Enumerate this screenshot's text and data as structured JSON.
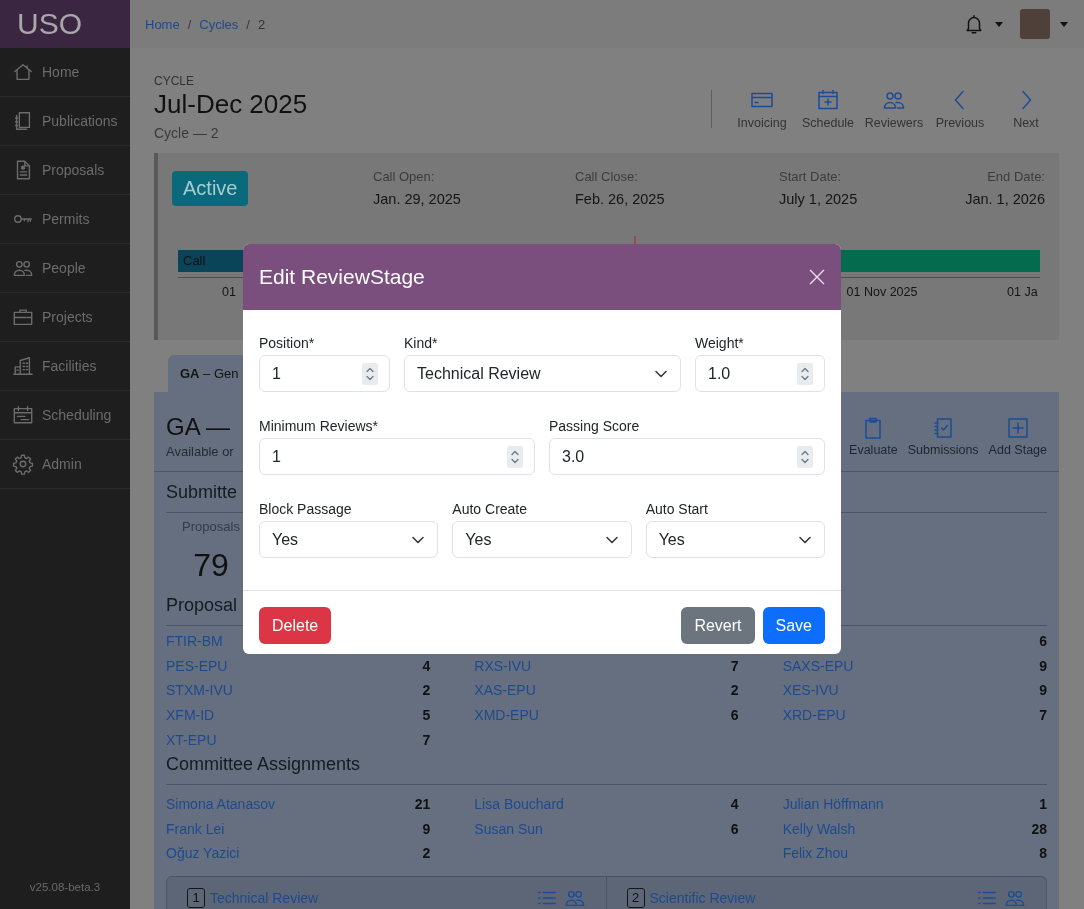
{
  "sidebar": {
    "logo": "USO",
    "items": [
      {
        "label": "Home"
      },
      {
        "label": "Publications"
      },
      {
        "label": "Proposals"
      },
      {
        "label": "Permits"
      },
      {
        "label": "People"
      },
      {
        "label": "Projects"
      },
      {
        "label": "Facilities"
      },
      {
        "label": "Scheduling"
      },
      {
        "label": "Admin"
      }
    ],
    "version": "v25.08-beta.3"
  },
  "breadcrumb": {
    "separator": "/",
    "items": [
      {
        "label": "Home",
        "kind": "link"
      },
      {
        "label": "Cycles",
        "kind": "link"
      },
      {
        "label": "2",
        "kind": "current"
      }
    ]
  },
  "header": {
    "eyebrow": "CYCLE",
    "title": "Jul-Dec 2025",
    "subtitle": "Cycle — 2",
    "actions": [
      {
        "label": "Invoicing"
      },
      {
        "label": "Schedule"
      },
      {
        "label": "Reviewers"
      },
      {
        "label": "Previous"
      },
      {
        "label": "Next"
      }
    ]
  },
  "summary": {
    "status": "Active",
    "dates": [
      {
        "label": "Call Open:",
        "value": "Jan. 29, 2025"
      },
      {
        "label": "Call Close:",
        "value": "Feb. 26, 2025"
      },
      {
        "label": "Start Date:",
        "value": "July 1, 2025"
      },
      {
        "label": "End Date:",
        "value": "Jan. 1, 2026"
      }
    ],
    "timeline": {
      "bar_label": "Call",
      "axis_labels": [
        "01",
        "01 Nov 2025",
        "01 Ja"
      ]
    }
  },
  "tabs": [
    {
      "label": "**GA** – Gen",
      "selected": true
    }
  ],
  "panel": {
    "title": "GA —",
    "subtitle": "Available or",
    "actions": [
      {
        "label": "Evaluate"
      },
      {
        "label": "Submissions"
      },
      {
        "label": "Add Stage"
      }
    ],
    "submitted": {
      "heading": "Submitte",
      "stats": [
        {
          "label": "Proposals",
          "value": "79"
        }
      ]
    },
    "proposals": {
      "heading": "Proposal",
      "rows": [
        {
          "column_1": {
            "name": "FTIR-BM"
          },
          "column_3": {
            "count": "6"
          }
        },
        {
          "column_1": {
            "name": "PES-EPU",
            "count": "4"
          },
          "column_2": {
            "name": "RXS-IVU",
            "count": "7"
          },
          "column_3": {
            "name": "SAXS-EPU",
            "count": "9"
          }
        },
        {
          "column_1": {
            "name": "STXM-IVU",
            "count": "2"
          },
          "column_2": {
            "name": "XAS-EPU",
            "count": "2"
          },
          "column_3": {
            "name": "XES-IVU",
            "count": "9"
          }
        },
        {
          "column_1": {
            "name": "XFM-ID",
            "count": "5"
          },
          "column_2": {
            "name": "XMD-EPU",
            "count": "6"
          },
          "column_3": {
            "name": "XRD-EPU",
            "count": "7"
          }
        },
        {
          "column_1": {
            "name": "XT-EPU",
            "count": "7"
          }
        }
      ]
    },
    "committee": {
      "heading": "Committee Assignments",
      "rows": [
        {
          "column_1": {
            "name": "Simona Atanasov",
            "count": "21"
          },
          "column_2": {
            "name": "Lisa Bouchard",
            "count": "4"
          },
          "column_3": {
            "name": "Julian Höffmann",
            "count": "1"
          }
        },
        {
          "column_1": {
            "name": "Frank Lei",
            "count": "9"
          },
          "column_2": {
            "name": "Susan Sun",
            "count": "6"
          },
          "column_3": {
            "name": "Kelly Walsh",
            "count": "28"
          }
        },
        {
          "column_1": {
            "name": "Oğuz Yazici",
            "count": "2"
          },
          "column_3": {
            "name": "Felix Zhou",
            "count": "8"
          }
        }
      ]
    },
    "stages": [
      {
        "number": "1",
        "name": "Technical Review"
      },
      {
        "number": "2",
        "name": "Scientific Review"
      }
    ]
  },
  "modal": {
    "title": "Edit ReviewStage",
    "rows": [
      {
        "fields": [
          {
            "kind": "number",
            "label": "Position*",
            "value": "1"
          },
          {
            "kind": "select",
            "label": "Kind*",
            "value": "Technical Review"
          },
          {
            "kind": "number",
            "label": "Weight*",
            "value": "1.0"
          }
        ]
      },
      {
        "fields": [
          {
            "kind": "number",
            "label": "Minimum Reviews*",
            "value": "1"
          },
          {
            "kind": "number",
            "label": "Passing Score",
            "value": "3.0"
          }
        ]
      },
      {
        "fields": [
          {
            "kind": "select",
            "label": "Block Passage",
            "value": "Yes"
          },
          {
            "kind": "select",
            "label": "Auto Create",
            "value": "Yes"
          },
          {
            "kind": "select",
            "label": "Auto Start",
            "value": "Yes"
          }
        ]
      }
    ],
    "buttons": [
      {
        "label": "Delete",
        "kind": "danger"
      },
      {
        "label": "Revert",
        "kind": "secondary"
      },
      {
        "label": "Save",
        "kind": "primary"
      }
    ]
  }
}
